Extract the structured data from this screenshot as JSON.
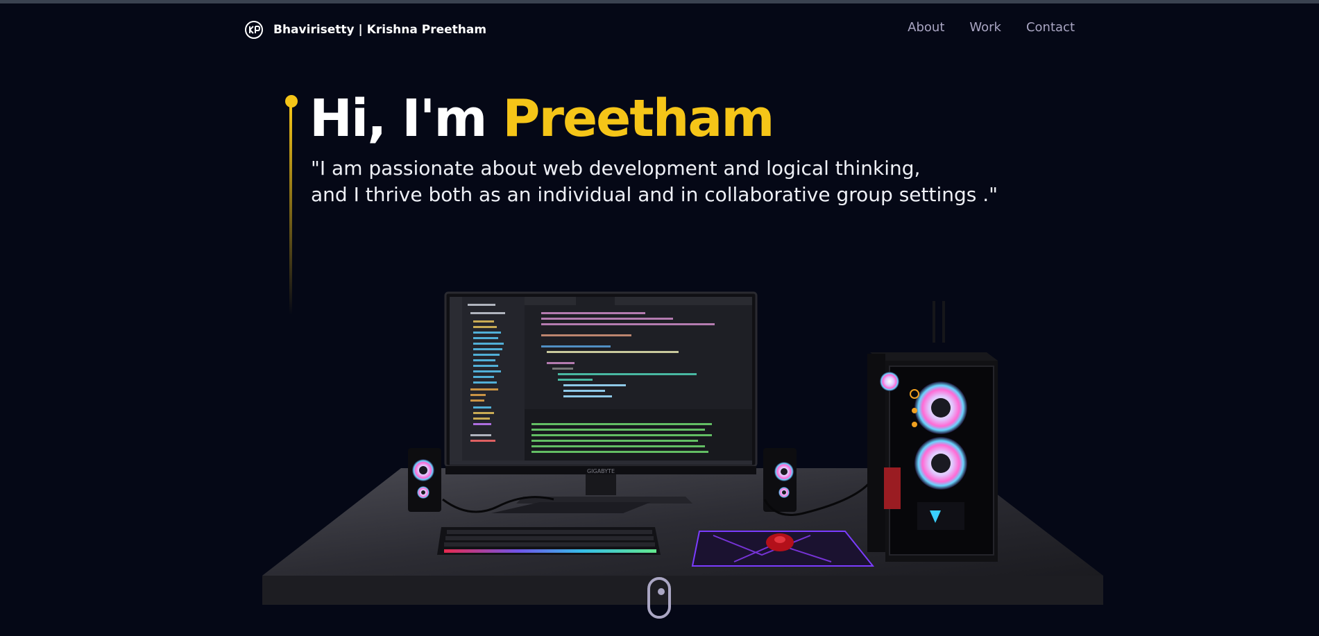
{
  "nav": {
    "brand": "Bhavirisetty | Krishna Preetham",
    "links": [
      "About",
      "Work",
      "Contact"
    ]
  },
  "hero": {
    "greeting": "Hi, I'm",
    "name": "Preetham",
    "tagline_line1": "\"I am passionate about web development and logical thinking,",
    "tagline_line2": "and I thrive both as an individual and in collaborative group settings .\""
  },
  "scene": {
    "monitor_brand": "GIGABYTE",
    "description_icon": "desktop-pc-3d-model"
  },
  "colors": {
    "background": "#050816",
    "accent": "#f5c518",
    "nav_text": "#aaa6c3"
  }
}
